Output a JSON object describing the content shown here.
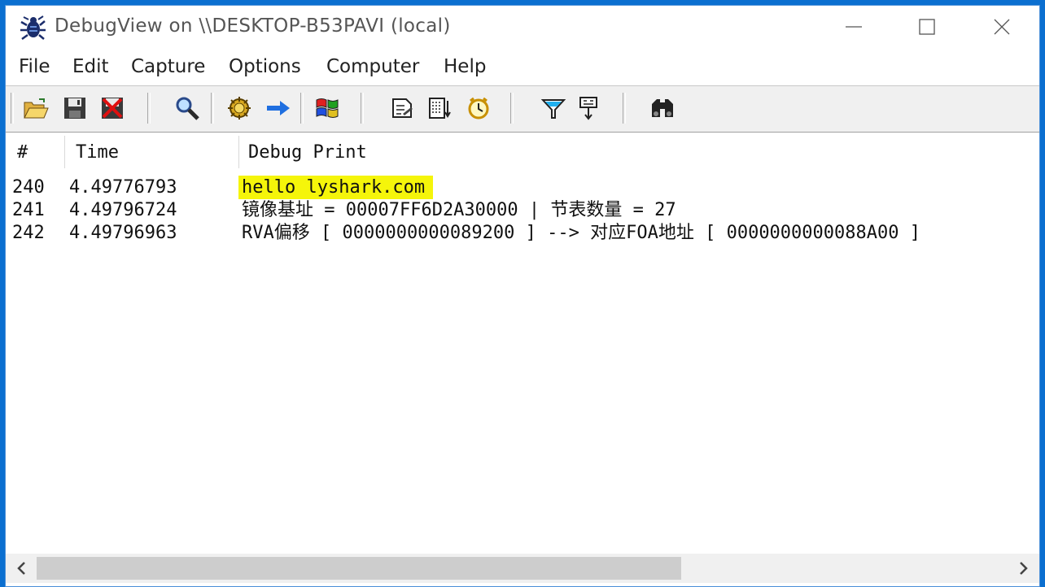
{
  "window": {
    "title": "DebugView on \\\\DESKTOP-B53PAVI (local)"
  },
  "menu": [
    "File",
    "Edit",
    "Capture",
    "Options",
    "Computer",
    "Help"
  ],
  "toolbar": {
    "icons": [
      "open-folder-icon",
      "save-icon",
      "clear-display-icon",
      "find-icon",
      "capture-icon",
      "autoscroll-arrow-icon",
      "windows-capture-icon",
      "time-format-icon",
      "clock-time-icon",
      "history-depth-icon",
      "filter-icon",
      "highlight-icon",
      "find-binoculars-icon"
    ]
  },
  "list": {
    "columns": [
      "#",
      "Time",
      "Debug Print"
    ],
    "rows": [
      {
        "num": "240",
        "time": "4.49776793",
        "msg": "hello lyshark.com",
        "highlight": true
      },
      {
        "num": "241",
        "time": "4.49796724",
        "msg": "镜像基址 = 00007FF6D2A30000 | 节表数量 = 27",
        "highlight": false
      },
      {
        "num": "242",
        "time": "4.49796963",
        "msg": "RVA偏移 [ 0000000000089200 ] --> 对应FOA地址 [ 0000000000088A00 ]",
        "highlight": false
      }
    ],
    "highlight_color": "#f5f50a"
  }
}
